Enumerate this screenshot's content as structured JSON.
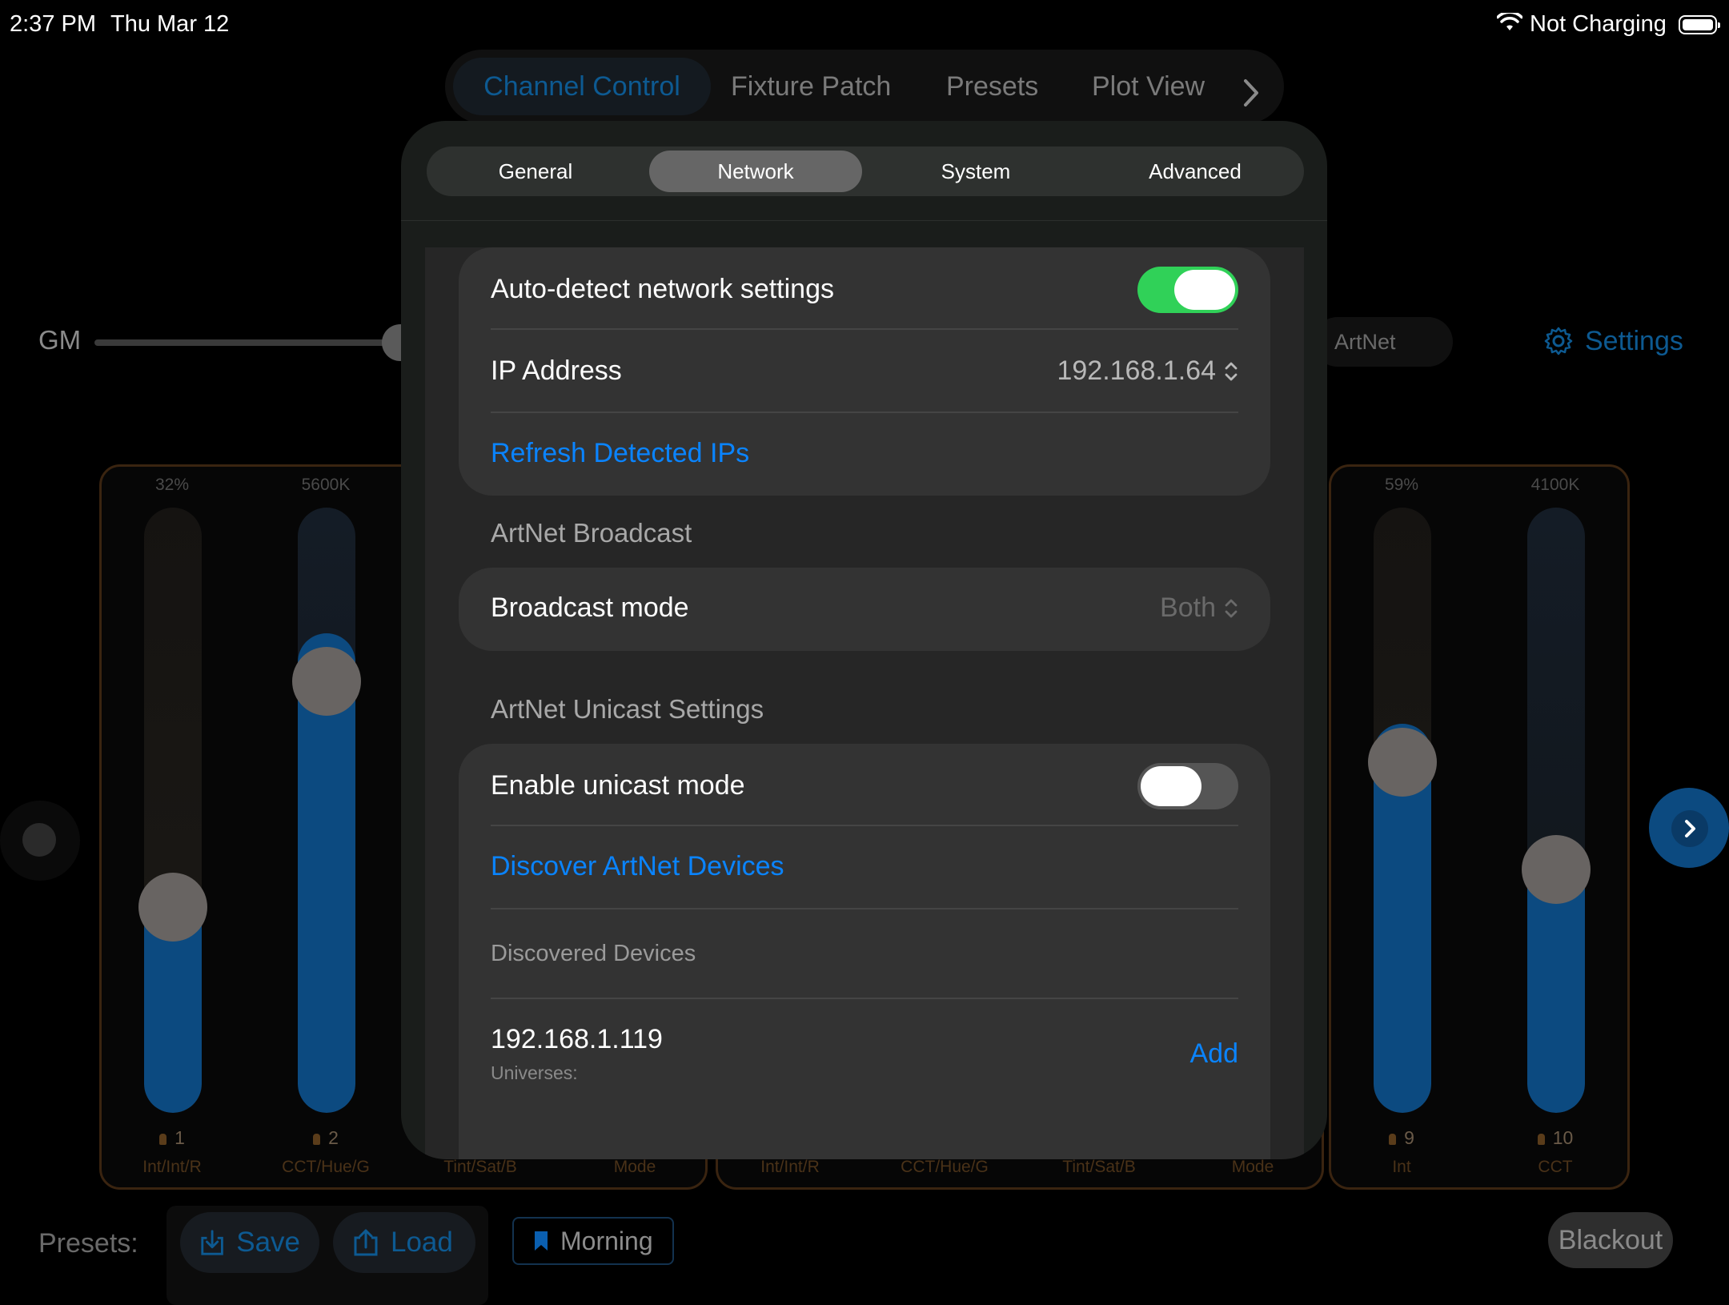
{
  "status_bar": {
    "time": "2:37 PM",
    "date": "Thu Mar 12",
    "battery_text": "Not Charging"
  },
  "top_nav": {
    "tabs": [
      "Channel Control",
      "Fixture Patch",
      "Presets",
      "Plot View"
    ]
  },
  "background": {
    "gm_label": "GM",
    "protocol_label": "ArtNet",
    "settings_label": "Settings",
    "faders": [
      {
        "value": "32%",
        "channel": "1",
        "name": "Int/Int/R",
        "level": 0.32
      },
      {
        "value": "5600K",
        "channel": "2",
        "name": "CCT/Hue/G",
        "level": 0.74
      },
      {
        "value": "",
        "channel": "",
        "name": "Tint/Sat/B",
        "level": 0
      },
      {
        "value": "",
        "channel": "",
        "name": "Mode",
        "level": 0
      },
      {
        "value": "",
        "channel": "",
        "name": "Int/Int/R",
        "level": 0
      },
      {
        "value": "",
        "channel": "",
        "name": "CCT/Hue/G",
        "level": 0
      },
      {
        "value": "",
        "channel": "",
        "name": "Tint/Sat/B",
        "level": 0
      },
      {
        "value": "",
        "channel": "",
        "name": "Mode",
        "level": 0
      },
      {
        "value": "59%",
        "channel": "9",
        "name": "Int",
        "level": 0.59
      },
      {
        "value": "4100K",
        "channel": "10",
        "name": "CCT",
        "level": 0.39
      }
    ]
  },
  "bottom_bar": {
    "presets_label": "Presets:",
    "save_label": "Save",
    "load_label": "Load",
    "current_preset": "Morning",
    "blackout_label": "Blackout"
  },
  "modal": {
    "tabs": [
      "General",
      "Network",
      "System",
      "Advanced"
    ],
    "selected_tab": "Network",
    "network": {
      "auto_detect_label": "Auto-detect network settings",
      "auto_detect_on": true,
      "ip_label": "IP Address",
      "ip_value": "192.168.1.64",
      "refresh_label": "Refresh Detected IPs",
      "broadcast_header": "ArtNet Broadcast",
      "broadcast_mode_label": "Broadcast mode",
      "broadcast_mode_value": "Both",
      "unicast_header": "ArtNet Unicast Settings",
      "enable_unicast_label": "Enable unicast mode",
      "enable_unicast_on": false,
      "discover_label": "Discover ArtNet Devices",
      "discovered_label": "Discovered Devices",
      "devices": [
        {
          "ip": "192.168.1.119",
          "universes_label": "Universes:",
          "add_label": "Add"
        }
      ]
    }
  },
  "colors": {
    "accent": "#0a84ff",
    "toggle_on": "#30d158",
    "fader_fill": "#0c4a80",
    "panel_border": "#3a2410"
  }
}
